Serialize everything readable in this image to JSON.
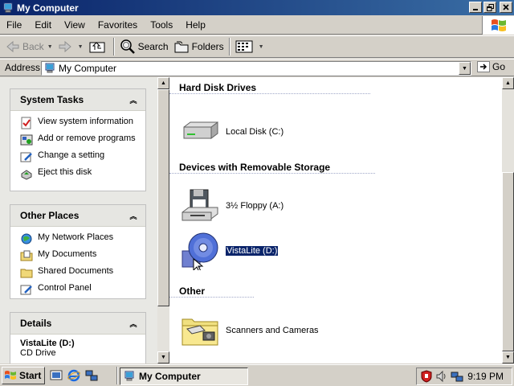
{
  "window": {
    "title": "My Computer"
  },
  "menu": [
    "File",
    "Edit",
    "View",
    "Favorites",
    "Tools",
    "Help"
  ],
  "toolbar": {
    "back": "Back",
    "search": "Search",
    "folders": "Folders"
  },
  "address": {
    "label": "Address",
    "value": "My Computer",
    "go": "Go"
  },
  "left": {
    "system_tasks": {
      "title": "System Tasks",
      "items": [
        "View system information",
        "Add or remove programs",
        "Change a setting",
        "Eject this disk"
      ]
    },
    "other_places": {
      "title": "Other Places",
      "items": [
        "My Network Places",
        "My Documents",
        "Shared Documents",
        "Control Panel"
      ]
    },
    "details": {
      "title": "Details",
      "name": "VistaLite (D:)",
      "type": "CD Drive"
    }
  },
  "right": {
    "groups": [
      {
        "title": "Hard Disk Drives",
        "items": [
          {
            "label": "Local Disk (C:)",
            "icon": "hard-disk-icon"
          }
        ]
      },
      {
        "title": "Devices with Removable Storage",
        "items": [
          {
            "label": "3½ Floppy (A:)",
            "icon": "floppy-drive-icon"
          },
          {
            "label": "VistaLite (D:)",
            "icon": "cd-drive-icon",
            "selected": true
          }
        ]
      },
      {
        "title": "Other",
        "items": [
          {
            "label": "Scanners and Cameras",
            "icon": "scanner-camera-folder-icon"
          }
        ]
      }
    ]
  },
  "taskbar": {
    "start": "Start",
    "active_window": "My Computer",
    "clock": "9:19 PM"
  },
  "colors": {
    "title_bar": "#0a246a",
    "selection": "#0a246a",
    "chrome": "#d4d0c8"
  }
}
